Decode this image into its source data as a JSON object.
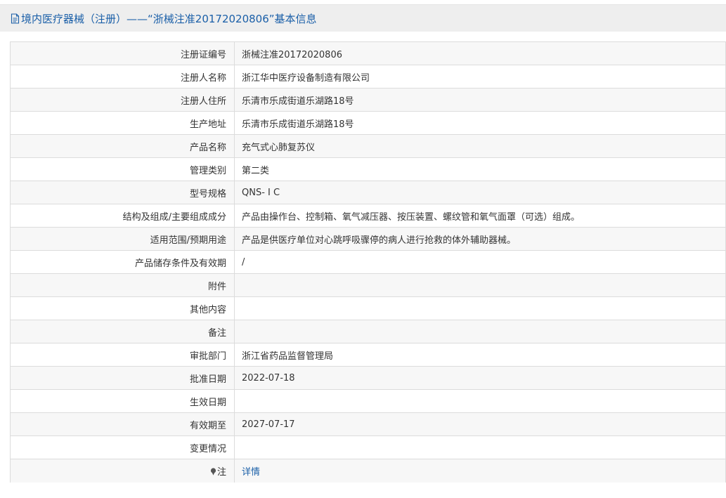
{
  "header": {
    "title": "境内医疗器械（注册）——“浙械注准20172020806”基本信息",
    "icon": "document-icon"
  },
  "rows": [
    {
      "label": "注册证编号",
      "value": "浙械注准20172020806"
    },
    {
      "label": "注册人名称",
      "value": "浙江华中医疗设备制造有限公司"
    },
    {
      "label": "注册人住所",
      "value": "乐清市乐成街道乐湖路18号"
    },
    {
      "label": "生产地址",
      "value": "乐清市乐成街道乐湖路18号"
    },
    {
      "label": "产品名称",
      "value": "充气式心肺复苏仪"
    },
    {
      "label": "管理类别",
      "value": "第二类"
    },
    {
      "label": "型号规格",
      "value": "QNS- I C"
    },
    {
      "label": "结构及组成/主要组成成分",
      "value": "产品由操作台、控制箱、氧气减压器、按压装置、螺纹管和氧气面罩（可选）组成。"
    },
    {
      "label": "适用范围/预期用途",
      "value": "产品是供医疗单位对心跳呼吸骤停的病人进行抢救的体外辅助器械。"
    },
    {
      "label": "产品储存条件及有效期",
      "value": "/"
    },
    {
      "label": "附件",
      "value": ""
    },
    {
      "label": "其他内容",
      "value": ""
    },
    {
      "label": "备注",
      "value": ""
    },
    {
      "label": "审批部门",
      "value": "浙江省药品监督管理局"
    },
    {
      "label": "批准日期",
      "value": "2022-07-18"
    },
    {
      "label": "生效日期",
      "value": ""
    },
    {
      "label": "有效期至",
      "value": "2027-07-17"
    },
    {
      "label": "变更情况",
      "value": ""
    }
  ],
  "note": {
    "label": "注",
    "icon": "pin-icon",
    "link": "详情"
  },
  "colors": {
    "accent": "#1a5fa8",
    "header_bg": "#eeeeee",
    "row_alt_bg": "#f7f7f7",
    "border": "#dcdcdc"
  }
}
